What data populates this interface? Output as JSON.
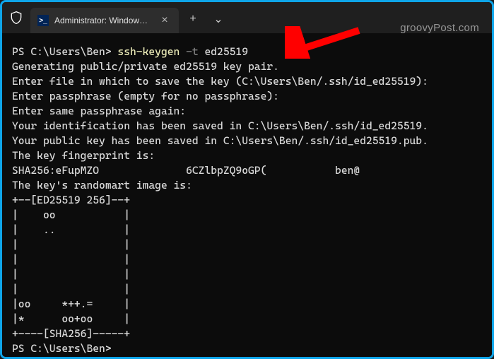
{
  "titlebar": {
    "tab_title": "Administrator: Windows Powe",
    "tab_icon_char": ">_",
    "close_label": "×",
    "newtab_label": "+",
    "dropdown_label": "⌄"
  },
  "watermark": "groovyPost.com",
  "terminal": {
    "prompt1_prefix": "PS C:\\Users\\Ben> ",
    "cmd": "ssh-keygen",
    "flag": " -t ",
    "arg": "ed25519",
    "lines": [
      "Generating public/private ed25519 key pair.",
      "Enter file in which to save the key (C:\\Users\\Ben/.ssh/id_ed25519):",
      "Enter passphrase (empty for no passphrase):",
      "Enter same passphrase again:",
      "Your identification has been saved in C:\\Users\\Ben/.ssh/id_ed25519.",
      "Your public key has been saved in C:\\Users\\Ben/.ssh/id_ed25519.pub.",
      "The key fingerprint is:",
      "SHA256:eFupMZO              6CZlbpZQ9oGP(           ben@",
      "The key's randomart image is:",
      "+--[ED25519 256]--+",
      "|    oo           |",
      "|    ..           |",
      "|                 |",
      "|                 |",
      "|                 |",
      "|                 |",
      "|oo     *++.=     |",
      "|*      oo+oo     |",
      "+----[SHA256]-----+"
    ],
    "prompt2": "PS C:\\Users\\Ben>"
  },
  "colors": {
    "frame_border": "#0ea5e9",
    "titlebar_bg": "#1f1f1f",
    "tab_bg": "#2d2d2d",
    "terminal_bg": "#0c0c0c",
    "terminal_fg": "#d9d9d9",
    "cmd_name": "#e9e9b6",
    "cmd_flag": "#808080",
    "arrow": "#ff0000"
  }
}
